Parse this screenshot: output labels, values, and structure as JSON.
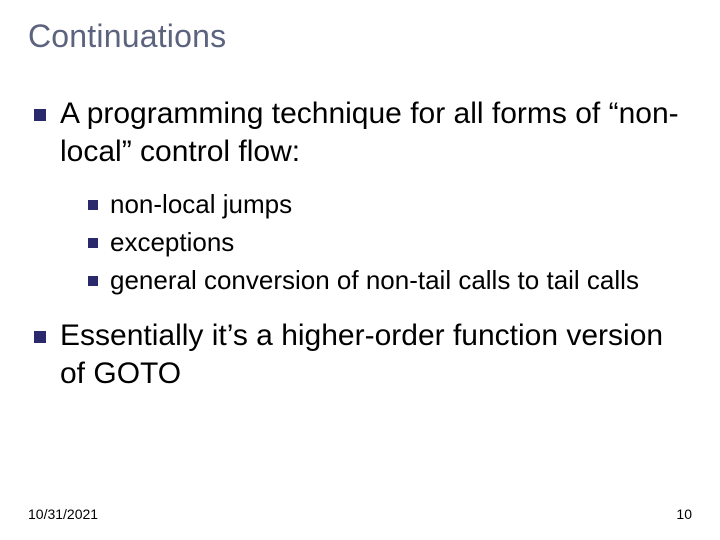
{
  "title": "Continuations",
  "bullets": {
    "b1": "A programming technique for all forms of “non-local” control flow:",
    "sub1": "non-local jumps",
    "sub2": "exceptions",
    "sub3": "general conversion of non-tail calls to tail calls",
    "b2": "Essentially it’s a higher-order function version of GOTO"
  },
  "footer": {
    "date": "10/31/2021",
    "page": "10"
  }
}
